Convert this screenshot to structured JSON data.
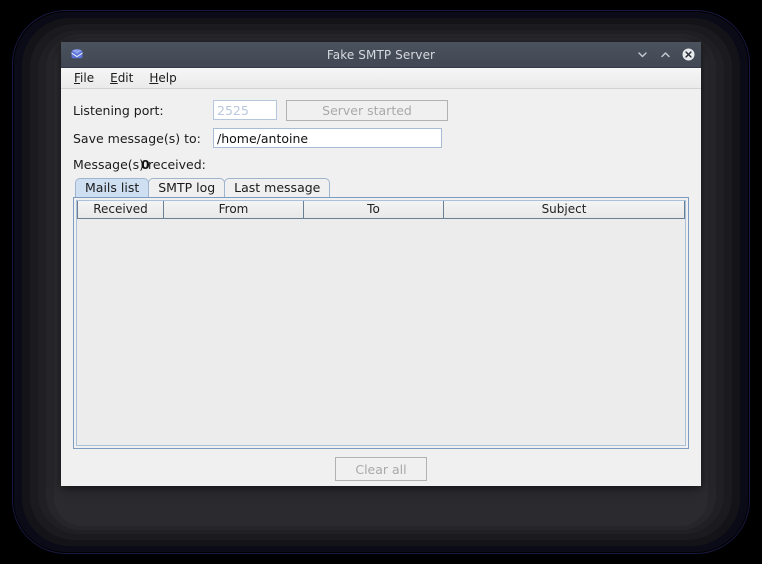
{
  "window": {
    "title": "Fake SMTP Server",
    "icon": "mail-envelope-icon",
    "controls": {
      "minimize": "minimize-chevron-down",
      "maximize": "maximize-chevron-up",
      "close": "close-circle-x"
    }
  },
  "menubar": {
    "items": [
      {
        "label": "File",
        "mnemonic": "F",
        "rest": "ile"
      },
      {
        "label": "Edit",
        "mnemonic": "E",
        "rest": "dit"
      },
      {
        "label": "Help",
        "mnemonic": "H",
        "rest": "elp"
      }
    ]
  },
  "form": {
    "port_label": "Listening port:",
    "port_value": "2525",
    "port_placeholder": "2525",
    "server_button_label": "Server started",
    "save_label": "Save message(s) to:",
    "save_value": "/home/antoine",
    "save_placeholder": "/home/antoine",
    "received_label": "Message(s) received:",
    "received_count": "0"
  },
  "tabs": [
    {
      "label": "Mails list",
      "selected": true
    },
    {
      "label": "SMTP log",
      "selected": false
    },
    {
      "label": "Last message",
      "selected": false
    }
  ],
  "table": {
    "columns": [
      "Received",
      "From",
      "To",
      "Subject"
    ],
    "rows": []
  },
  "footer": {
    "clear_button_label": "Clear all"
  },
  "colors": {
    "titlebar": "#434a54",
    "titlebar_text": "#d6d9de",
    "window_bg": "#f0f0f0",
    "tab_selected": "#cfdff2",
    "pane_border": "#7c9cc0",
    "disabled_text": "#a9a9a9",
    "field_text_disabled": "#b9c8dc",
    "desktop": "#000000"
  }
}
